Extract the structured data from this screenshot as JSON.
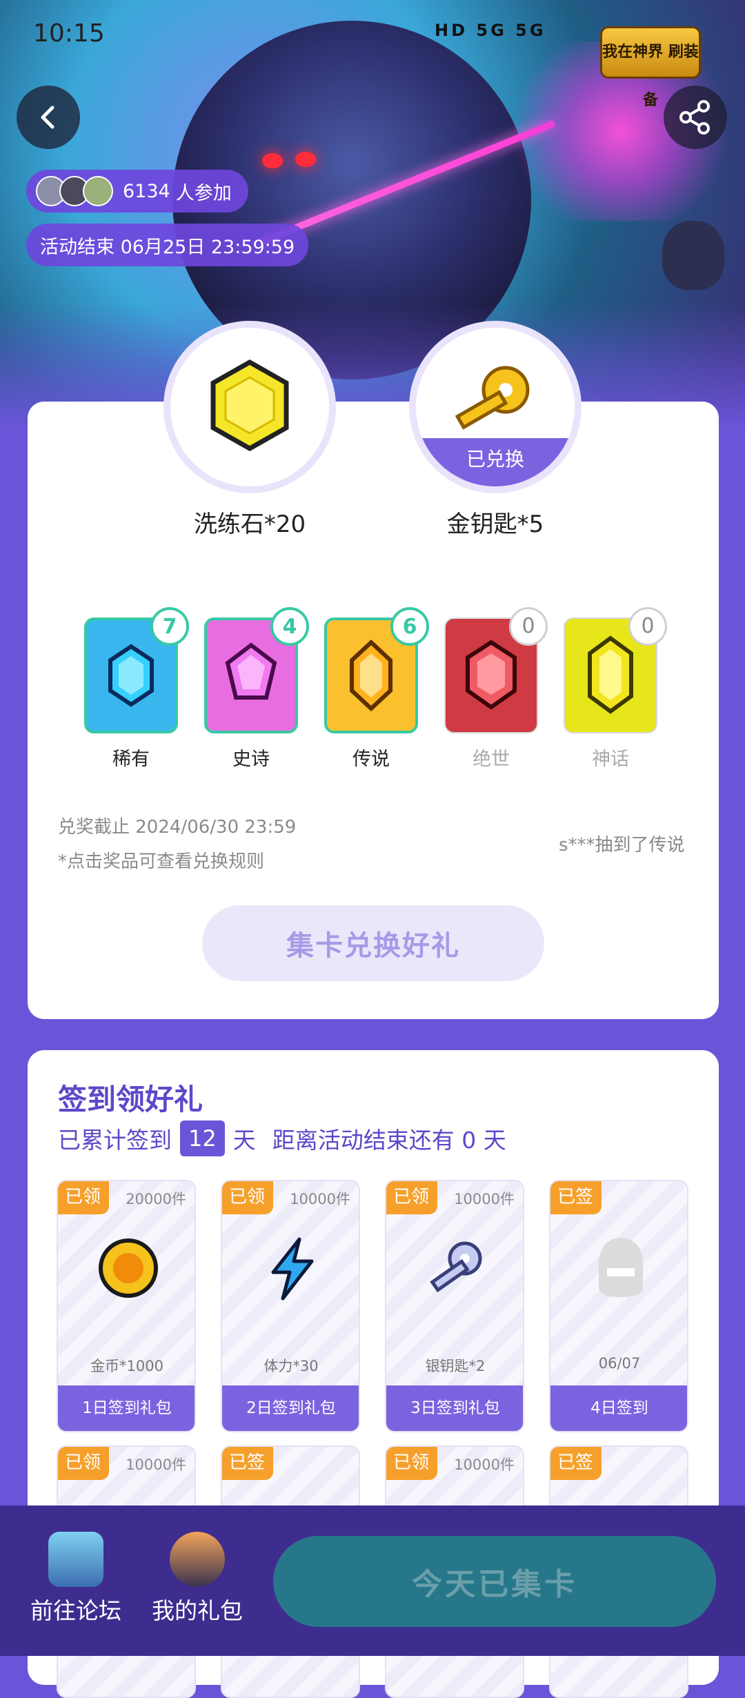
{
  "status_bar": {
    "time": "10:15",
    "icons_text": "HD 5G 5G"
  },
  "hero": {
    "game_logo_text": "我在神界 刷装备",
    "participants_count": "6134",
    "participants_suffix": "人参加",
    "event_end": "活动结束 06月25日 23:59:59"
  },
  "rewards": [
    {
      "name": "洗练石*20",
      "status": ""
    },
    {
      "name": "金钥匙*5",
      "status": "已兑换"
    }
  ],
  "gems": [
    {
      "label": "稀有",
      "count": "7",
      "color": "#3ab6ee",
      "active": true
    },
    {
      "label": "史诗",
      "count": "4",
      "color": "#e86de0",
      "active": true
    },
    {
      "label": "传说",
      "count": "6",
      "color": "#fbc02d",
      "active": true
    },
    {
      "label": "绝世",
      "count": "0",
      "color": "#d03a43",
      "active": false
    },
    {
      "label": "神话",
      "count": "0",
      "color": "#e6e61a",
      "active": false
    }
  ],
  "info": {
    "deadline": "兑奖截止 2024/06/30 23:59",
    "rule_hint": "*点击奖品可查看兑换规则",
    "recent_draw": "s***抽到了传说"
  },
  "exchange_button": "集卡兑换好礼",
  "signin": {
    "title": "签到领好礼",
    "prefix": "已累计签到",
    "days": "12",
    "days_unit": "天",
    "remaining": "距离活动结束还有 0 天",
    "tiles": [
      {
        "tag": "已领",
        "count": "20000件",
        "name": "金币*1000",
        "bar": "1日签到礼包",
        "icon": "gold-coin-icon"
      },
      {
        "tag": "已领",
        "count": "10000件",
        "name": "体力*30",
        "bar": "2日签到礼包",
        "icon": "lightning-icon"
      },
      {
        "tag": "已领",
        "count": "10000件",
        "name": "银钥匙*2",
        "bar": "3日签到礼包",
        "icon": "silver-key-icon"
      },
      {
        "tag": "已签",
        "count": "",
        "name": "06/07",
        "bar": "4日签到",
        "icon": "character-silhouette-icon"
      }
    ],
    "tiles_row2": [
      {
        "tag": "已领",
        "count": "10000件"
      },
      {
        "tag": "已签",
        "count": ""
      },
      {
        "tag": "已领",
        "count": "10000件"
      },
      {
        "tag": "已签",
        "count": ""
      }
    ]
  },
  "bottom_nav": {
    "forum": "前往论坛",
    "gifts": "我的礼包",
    "collect_button": "今天已集卡"
  }
}
